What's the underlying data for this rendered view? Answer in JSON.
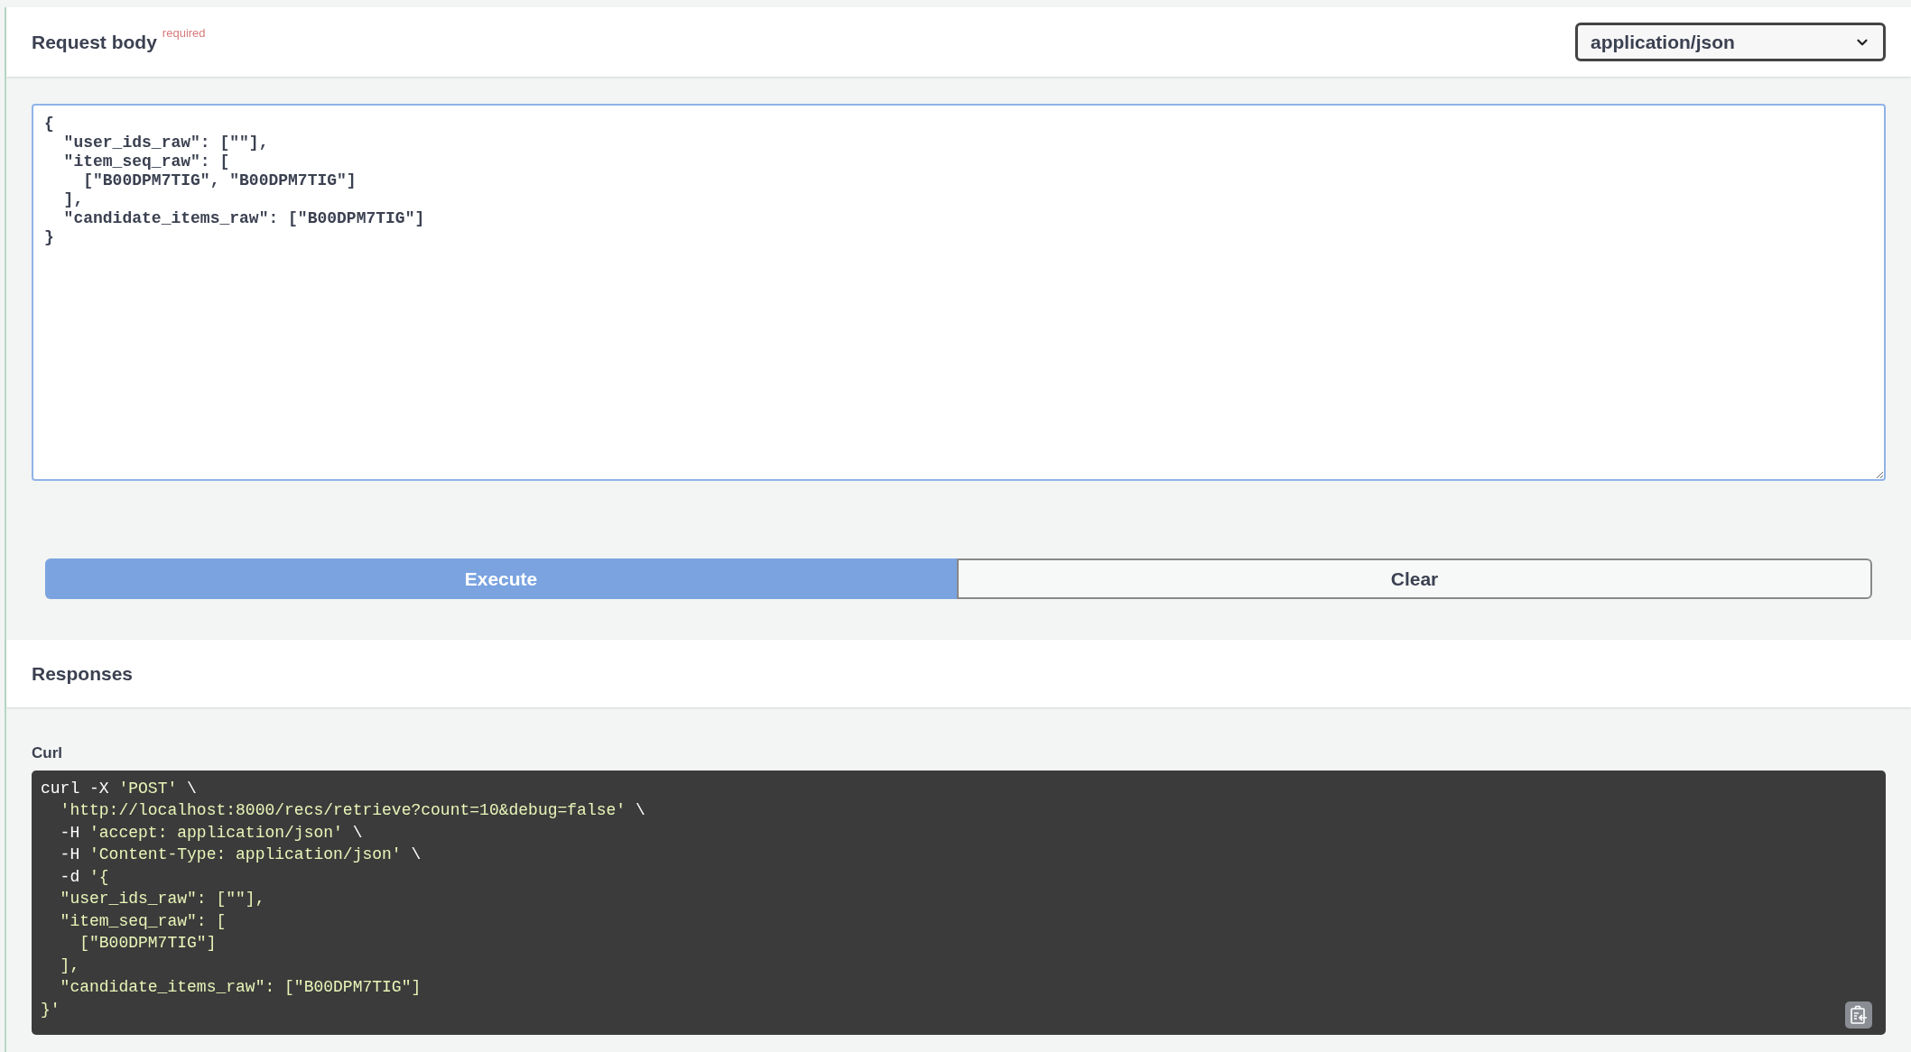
{
  "request_body": {
    "title": "Request body",
    "required_label": "required",
    "content_type": "application/json",
    "value": "{\n  \"user_ids_raw\": [\"\"],\n  \"item_seq_raw\": [\n    [\"B00DPM7TIG\", \"B00DPM7TIG\"]\n  ],\n  \"candidate_items_raw\": [\"B00DPM7TIG\"]\n}"
  },
  "buttons": [
    {
      "label": "Execute",
      "kind": "primary"
    },
    {
      "label": "Clear",
      "kind": "secondary"
    }
  ],
  "responses": {
    "title": "Responses",
    "curl_label": "Curl",
    "curl_lines": [
      [
        {
          "text": "curl -X ",
          "kind": "plain"
        },
        {
          "text": "'POST'",
          "kind": "string"
        },
        {
          "text": " \\",
          "kind": "plain"
        }
      ],
      [
        {
          "text": "  'http://localhost:8000/recs/retrieve?count=10&debug=false'",
          "kind": "string"
        },
        {
          "text": " \\",
          "kind": "plain"
        }
      ],
      [
        {
          "text": "  -H ",
          "kind": "plain"
        },
        {
          "text": "'accept: application/json'",
          "kind": "string"
        },
        {
          "text": " \\",
          "kind": "plain"
        }
      ],
      [
        {
          "text": "  -H ",
          "kind": "plain"
        },
        {
          "text": "'Content-Type: application/json'",
          "kind": "string"
        },
        {
          "text": " \\",
          "kind": "plain"
        }
      ],
      [
        {
          "text": "  -d ",
          "kind": "plain"
        },
        {
          "text": "'{",
          "kind": "string"
        }
      ],
      [
        {
          "text": "  \"user_ids_raw\": [\"\"],",
          "kind": "string"
        }
      ],
      [
        {
          "text": "  \"item_seq_raw\": [",
          "kind": "string"
        }
      ],
      [
        {
          "text": "    [\"B00DPM7TIG\"]",
          "kind": "string"
        }
      ],
      [
        {
          "text": "  ],",
          "kind": "string"
        }
      ],
      [
        {
          "text": "  \"candidate_items_raw\": [\"B00DPM7TIG\"]",
          "kind": "string"
        }
      ],
      [
        {
          "text": "}'",
          "kind": "string"
        }
      ]
    ]
  }
}
